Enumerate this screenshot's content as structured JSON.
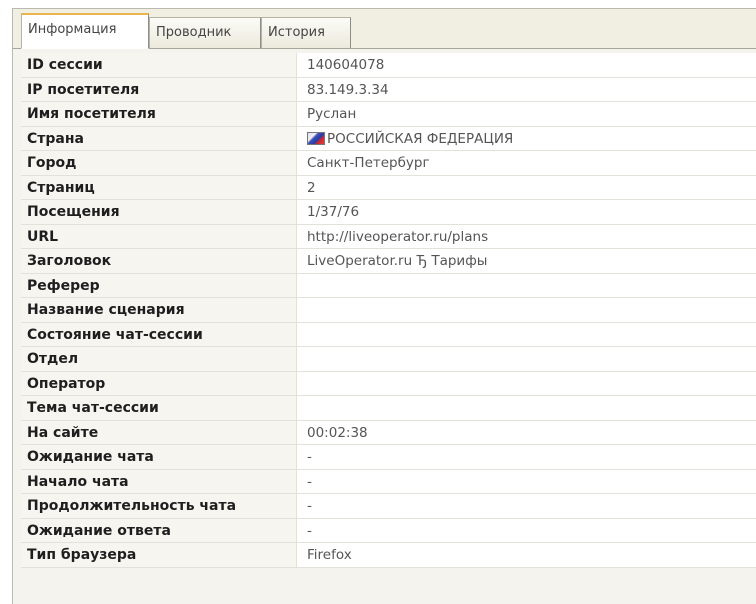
{
  "tabs": [
    {
      "label": "Информация",
      "active": true
    },
    {
      "label": "Проводник",
      "active": false
    },
    {
      "label": "История",
      "active": false
    }
  ],
  "rows": [
    {
      "label": "ID сессии",
      "value": "140604078"
    },
    {
      "label": "IP посетителя",
      "value": "83.149.3.34"
    },
    {
      "label": "Имя посетителя",
      "value": "Руслан"
    },
    {
      "label": "Страна",
      "value": "РОССИЙСКАЯ ФЕДЕРАЦИЯ",
      "icon": "russia-flag-icon"
    },
    {
      "label": "Город",
      "value": "Санкт-Петербург"
    },
    {
      "label": "Страниц",
      "value": "2"
    },
    {
      "label": "Посещения",
      "value": "1/37/76"
    },
    {
      "label": "URL",
      "value": "http://liveoperator.ru/plans"
    },
    {
      "label": "Заголовок",
      "value": "LiveOperator.ru Ђ Тарифы"
    },
    {
      "label": "Реферер",
      "value": ""
    },
    {
      "label": "Название сценария",
      "value": ""
    },
    {
      "label": "Состояние чат-сессии",
      "value": ""
    },
    {
      "label": "Отдел",
      "value": ""
    },
    {
      "label": "Оператор",
      "value": ""
    },
    {
      "label": "Тема чат-сессии",
      "value": ""
    },
    {
      "label": "На сайте",
      "value": "00:02:38"
    },
    {
      "label": "Ожидание чата",
      "value": "-"
    },
    {
      "label": "Начало чата",
      "value": "-"
    },
    {
      "label": "Продолжительность чата",
      "value": "-"
    },
    {
      "label": "Ожидание ответа",
      "value": "-"
    },
    {
      "label": "Тип браузера",
      "value": "Firefox"
    }
  ]
}
